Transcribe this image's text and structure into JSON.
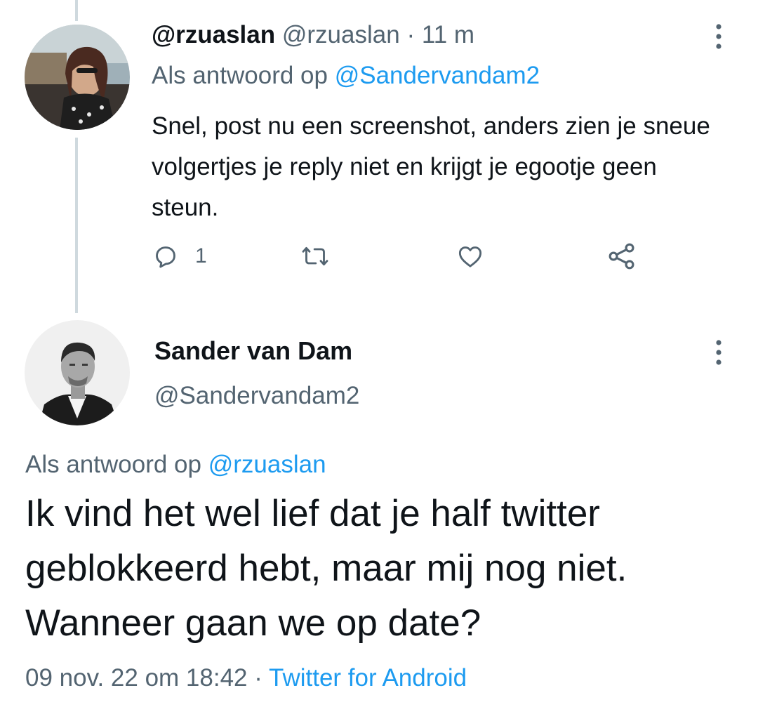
{
  "reply_tweet": {
    "display_name": "@rzuaslan",
    "handle": "@rzuaslan",
    "separator": "·",
    "time": "11 m",
    "reply_prefix": "Als antwoord op",
    "reply_to": "@Sandervandam2",
    "text": "Snel, post nu een screenshot, anders zien je sneue volgertjes je reply niet en krijgt je egootje geen steun.",
    "actions": {
      "reply_icon": "reply-icon",
      "reply_count": "1",
      "retweet_icon": "retweet-icon",
      "like_icon": "heart-icon",
      "share_icon": "share-icon"
    }
  },
  "main_tweet": {
    "display_name": "Sander van Dam",
    "handle": "@Sandervandam2",
    "reply_prefix": "Als antwoord op",
    "reply_to": "@rzuaslan",
    "text": "Ik vind het wel lief dat je half twitter geblokkeerd hebt, maar mij nog niet. Wanneer gaan we op date?",
    "timestamp": "09 nov. 22 om 18:42",
    "separator": "·",
    "source": "Twitter for Android"
  },
  "colors": {
    "text": "#0f1419",
    "muted": "#536471",
    "link": "#1d9bf0",
    "thread_line": "#cfd9de"
  }
}
